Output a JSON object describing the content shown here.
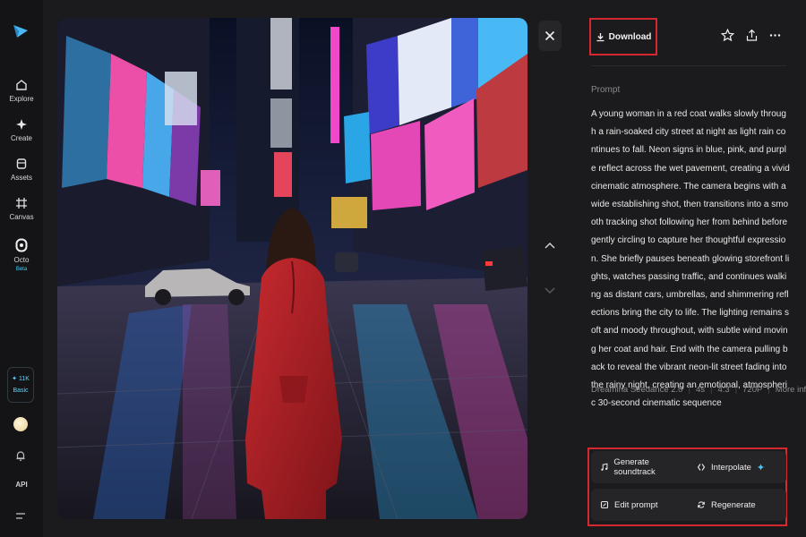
{
  "sidebar": {
    "logo_icon": "paper-plane-logo",
    "items": [
      {
        "label": "Explore",
        "icon": "home-icon"
      },
      {
        "label": "Create",
        "icon": "sparkle-icon"
      },
      {
        "label": "Assets",
        "icon": "folder-icon"
      },
      {
        "label": "Canvas",
        "icon": "canvas-icon"
      },
      {
        "label": "Octo",
        "icon": "octo-icon",
        "badge": "Beta"
      }
    ],
    "plan": {
      "credits": "11K",
      "tier": "Basic"
    },
    "api_label": "API"
  },
  "viewer": {
    "image_description_icon": "generated-video-frame",
    "close_icon": "close-icon",
    "prev_icon": "chevron-up-icon",
    "next_icon": "chevron-down-icon"
  },
  "panel": {
    "download_label": "Download",
    "prompt_label": "Prompt",
    "prompt_text": "A young woman in a red coat walks slowly through a rain-soaked city street at night as light rain continues to fall. Neon signs in blue, pink, and purple reflect across the wet pavement, creating a vivid cinematic atmosphere. The camera begins with a wide establishing shot, then transitions into a smooth tracking shot following her from behind before gently circling to capture her thoughtful expression. She briefly pauses beneath glowing storefront lights, watches passing traffic, and continues walking as distant cars, umbrellas, and shimmering reflections bring the city to life. The lighting remains soft and moody throughout, with subtle wind moving her coat and hair. End with the camera pulling back to reveal the vibrant neon-lit street fading into the rainy night, creating an emotional, atmospheric 30-second cinematic sequence",
    "meta": {
      "model": "Dreamina Seedance 2.0",
      "duration": "4s",
      "ratio": "4:3",
      "resolution": "720P",
      "more_info": "More info"
    },
    "actions": {
      "generate_soundtrack": "Generate soundtrack",
      "interpolate": "Interpolate",
      "edit_prompt": "Edit prompt",
      "regenerate": "Regenerate"
    }
  },
  "colors": {
    "highlight": "#d7282f",
    "accent": "#47c8ff",
    "background": "#1b1b1d"
  }
}
